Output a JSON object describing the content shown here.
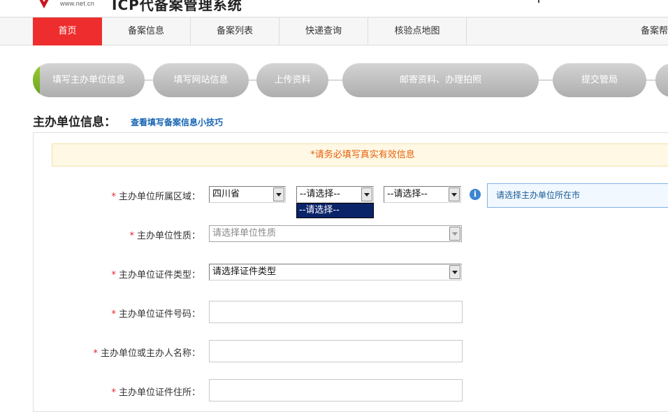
{
  "header": {
    "logo_url": "www.net.cn",
    "system_title": "ICP代备案管理系统"
  },
  "nav": {
    "items": [
      {
        "label": "首页",
        "active": true
      },
      {
        "label": "备案信息",
        "active": false
      },
      {
        "label": "备案列表",
        "active": false
      },
      {
        "label": "快递查询",
        "active": false
      },
      {
        "label": "核验点地图",
        "active": false
      },
      {
        "label": "备案帮",
        "active": false
      }
    ]
  },
  "steps": [
    {
      "label": "填写主办单位信息",
      "current": true
    },
    {
      "label": "填写网站信息",
      "current": false
    },
    {
      "label": "上传资料",
      "current": false
    },
    {
      "label": "邮寄资料、办理拍照",
      "current": false
    },
    {
      "label": "提交管局",
      "current": false
    }
  ],
  "section": {
    "title": "主办单位信息：",
    "tips_link": "查看填写备案信息小技巧"
  },
  "notice": "*请务必填写真实有效信息",
  "form": {
    "required_mark": "*",
    "region": {
      "label": "主办单位所属区域：",
      "province": "四川省",
      "city": "--请选择--",
      "district": "--请选择--",
      "open_option": "--请选择--",
      "hint": "请选择主办单位所在市"
    },
    "nature": {
      "label": "主办单位性质：",
      "value": "请选择单位性质"
    },
    "id_type": {
      "label": "主办单位证件类型：",
      "value": "请选择证件类型"
    },
    "id_number": {
      "label": "主办单位证件号码："
    },
    "org_name": {
      "label": "主办单位或主办人名称："
    },
    "id_address": {
      "label": "主办单位证件住所："
    }
  },
  "colors": {
    "brand_red": "#ee2e2e",
    "link_blue": "#1565b4",
    "notice_orange": "#e8600c",
    "step_accent_green": "#7cb82f"
  }
}
